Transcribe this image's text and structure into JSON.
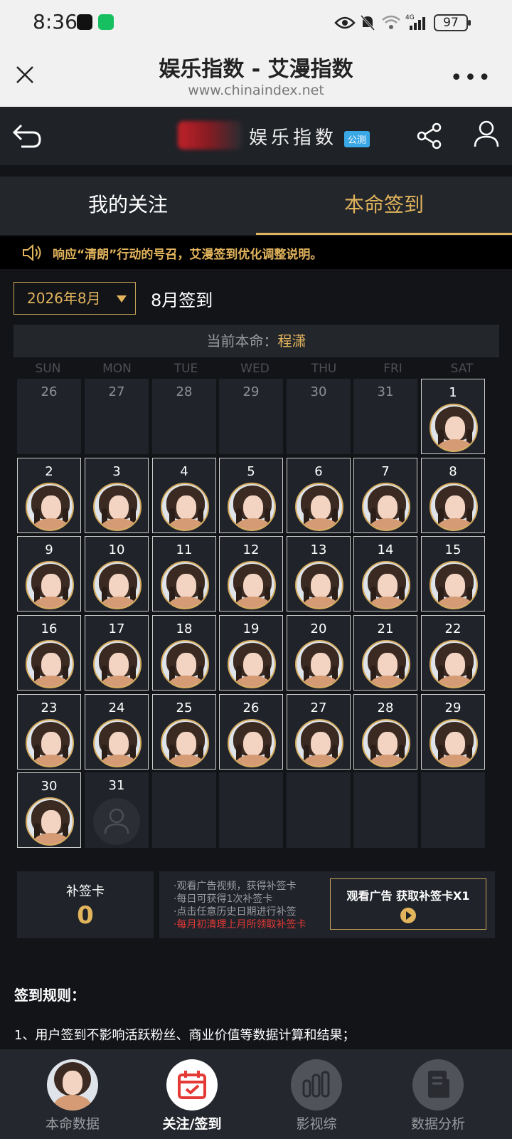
{
  "statusbar": {
    "time": "8:36",
    "battery": "97"
  },
  "browser": {
    "title": "娱乐指数 - 艾漫指数",
    "url": "www.chinaindex.net"
  },
  "header": {
    "brand": "娱乐指数",
    "beta": "公测"
  },
  "tabs": [
    {
      "label": "我的关注",
      "active": false
    },
    {
      "label": "本命签到",
      "active": true
    }
  ],
  "notice": "响应“清朗”行动的号召，艾漫签到优化调整说明。",
  "month_select": {
    "value": "2026年8月"
  },
  "month_title": "8月签到",
  "current_idol": {
    "label": "当前本命：",
    "name": "程潇"
  },
  "weekdays": [
    "SUN",
    "MON",
    "TUE",
    "WED",
    "THU",
    "FRI",
    "SAT"
  ],
  "calendar": {
    "prev_days": [
      "26",
      "27",
      "28",
      "29",
      "30",
      "31"
    ],
    "days": [
      "1",
      "2",
      "3",
      "4",
      "5",
      "6",
      "7",
      "8",
      "9",
      "10",
      "11",
      "12",
      "13",
      "14",
      "15",
      "16",
      "17",
      "18",
      "19",
      "20",
      "21",
      "22",
      "23",
      "24",
      "25",
      "26",
      "27",
      "28",
      "29",
      "30",
      "31"
    ],
    "signed_through": 30
  },
  "makeup_card": {
    "label": "补签卡",
    "count": "0"
  },
  "info_lines": [
    "·观看广告视频，获得补签卡",
    "·每日可获得1次补签卡",
    "·点击任意历史日期进行补签"
  ],
  "info_warning": "·每月初清理上月所领取补签卡",
  "ad_button": "观看广告 获取补签卡X1",
  "rules": {
    "title": "签到规则：",
    "line1": "1、用户签到不影响活跃粉丝、商业价值等数据计算和结果；"
  },
  "bottom_nav": [
    {
      "label": "本命数据",
      "icon": "avatar-icon"
    },
    {
      "label": "关注/签到",
      "icon": "calendar-icon",
      "active": true
    },
    {
      "label": "影视综",
      "icon": "bar-chart-icon"
    },
    {
      "label": "数据分析",
      "icon": "document-icon"
    }
  ],
  "colors": {
    "accent": "#e2b45c",
    "background": "#121418",
    "warning": "#e53935"
  }
}
